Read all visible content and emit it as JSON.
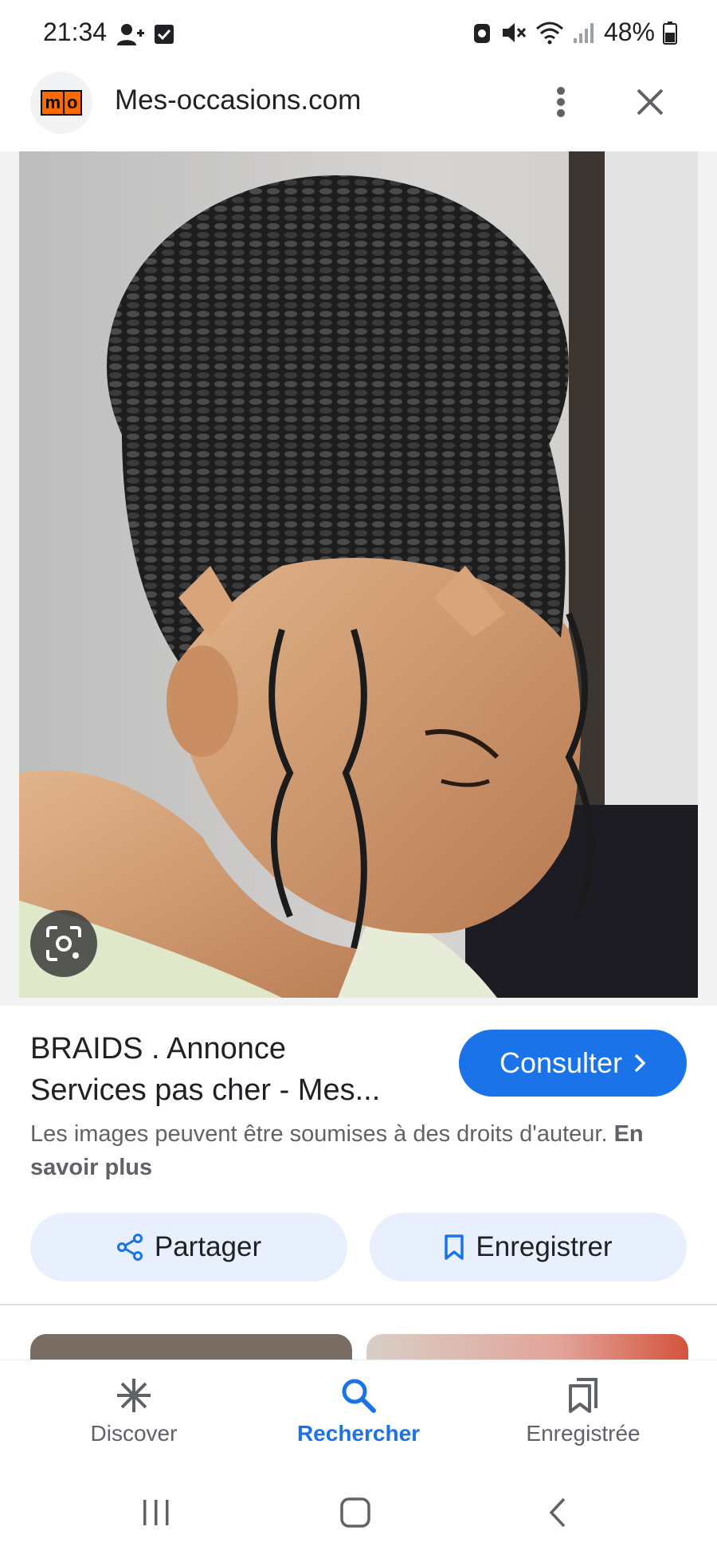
{
  "status_bar": {
    "time": "21:34",
    "battery_percent": "48%"
  },
  "tab_header": {
    "logo_text_m": "m",
    "logo_text_o": "o",
    "site_title": "Mes-occasions.com"
  },
  "result": {
    "title_line1": "BRAIDS . Annonce",
    "title_line2": "Services pas cher - Mes...",
    "consult_label": "Consulter",
    "copyright_text": "Les images peuvent être soumises à des droits d'auteur.",
    "learn_more": "En savoir plus"
  },
  "actions": {
    "share_label": "Partager",
    "save_label": "Enregistrer"
  },
  "bottom_nav": {
    "discover": "Discover",
    "search": "Rechercher",
    "saved": "Enregistrée"
  },
  "colors": {
    "accent": "#1a73e8",
    "chip_bg": "#e8f0fe",
    "text_secondary": "#5f6368"
  }
}
